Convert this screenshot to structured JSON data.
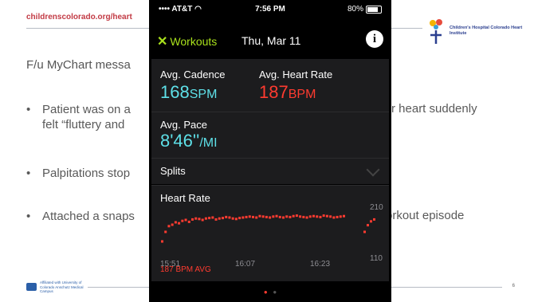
{
  "slide": {
    "url": "childrenscolorado.org/heart",
    "logo_text": "Children's Hospital Colorado Heart Institute",
    "cu_logo_text": "Affiliated with University of Colorado Anschutz Medical Campus",
    "page_number": "6",
    "fu_line": "F/u MyChart messa",
    "bullets": [
      {
        "left": "Patient was on a",
        "left2": "felt “fluttery and",
        "right": "r heart suddenly"
      },
      {
        "left": "Palpitations stop"
      },
      {
        "left": "Attached a snaps",
        "right": "orkout episode"
      }
    ],
    "bullet_glyph": "•"
  },
  "phone": {
    "status": {
      "carrier": "•••• AT&T ◠",
      "time": "7:56 PM",
      "battery": "80%",
      "battery_level": 0.8
    },
    "nav": {
      "back_icon": "✕",
      "back_label": "Workouts",
      "title": "Thu, Mar 11",
      "info_glyph": "i"
    },
    "metrics": {
      "cadence_label": "Avg. Cadence",
      "cadence_value": "168",
      "cadence_unit": "SPM",
      "hr_label": "Avg. Heart Rate",
      "hr_value": "187",
      "hr_unit": "BPM",
      "pace_label": "Avg. Pace",
      "pace_value": "8'46''",
      "pace_unit": "/MI"
    },
    "splits_label": "Splits",
    "heart_rate": {
      "title": "Heart Rate",
      "y_max_label": "210",
      "y_min_label": "110",
      "x_labels": [
        "15:51",
        "16:07",
        "16:23"
      ],
      "avg_label": "187 BPM AVG"
    },
    "page_dots": [
      "●",
      "●"
    ]
  },
  "chart_data": {
    "type": "scatter",
    "title": "Heart Rate",
    "ylim": [
      110,
      210
    ],
    "x_tick_labels": [
      "15:51",
      "16:07",
      "16:23"
    ],
    "series": [
      {
        "values": [
          140,
          160,
          172,
          175,
          180,
          178,
          183,
          185,
          181,
          186,
          188,
          187,
          185,
          188,
          189,
          190,
          186,
          188,
          189,
          191,
          190,
          188,
          187,
          189,
          190,
          191,
          192,
          191,
          190,
          193,
          192,
          191,
          190,
          192,
          193,
          191,
          190,
          192,
          191,
          193,
          194,
          192,
          191,
          190,
          192,
          193,
          192,
          191,
          194,
          193,
          192,
          190,
          191,
          192,
          193
        ]
      },
      {
        "values": [
          160,
          174,
          182,
          186
        ]
      }
    ],
    "colors": {
      "points": "#ff3b30"
    }
  }
}
